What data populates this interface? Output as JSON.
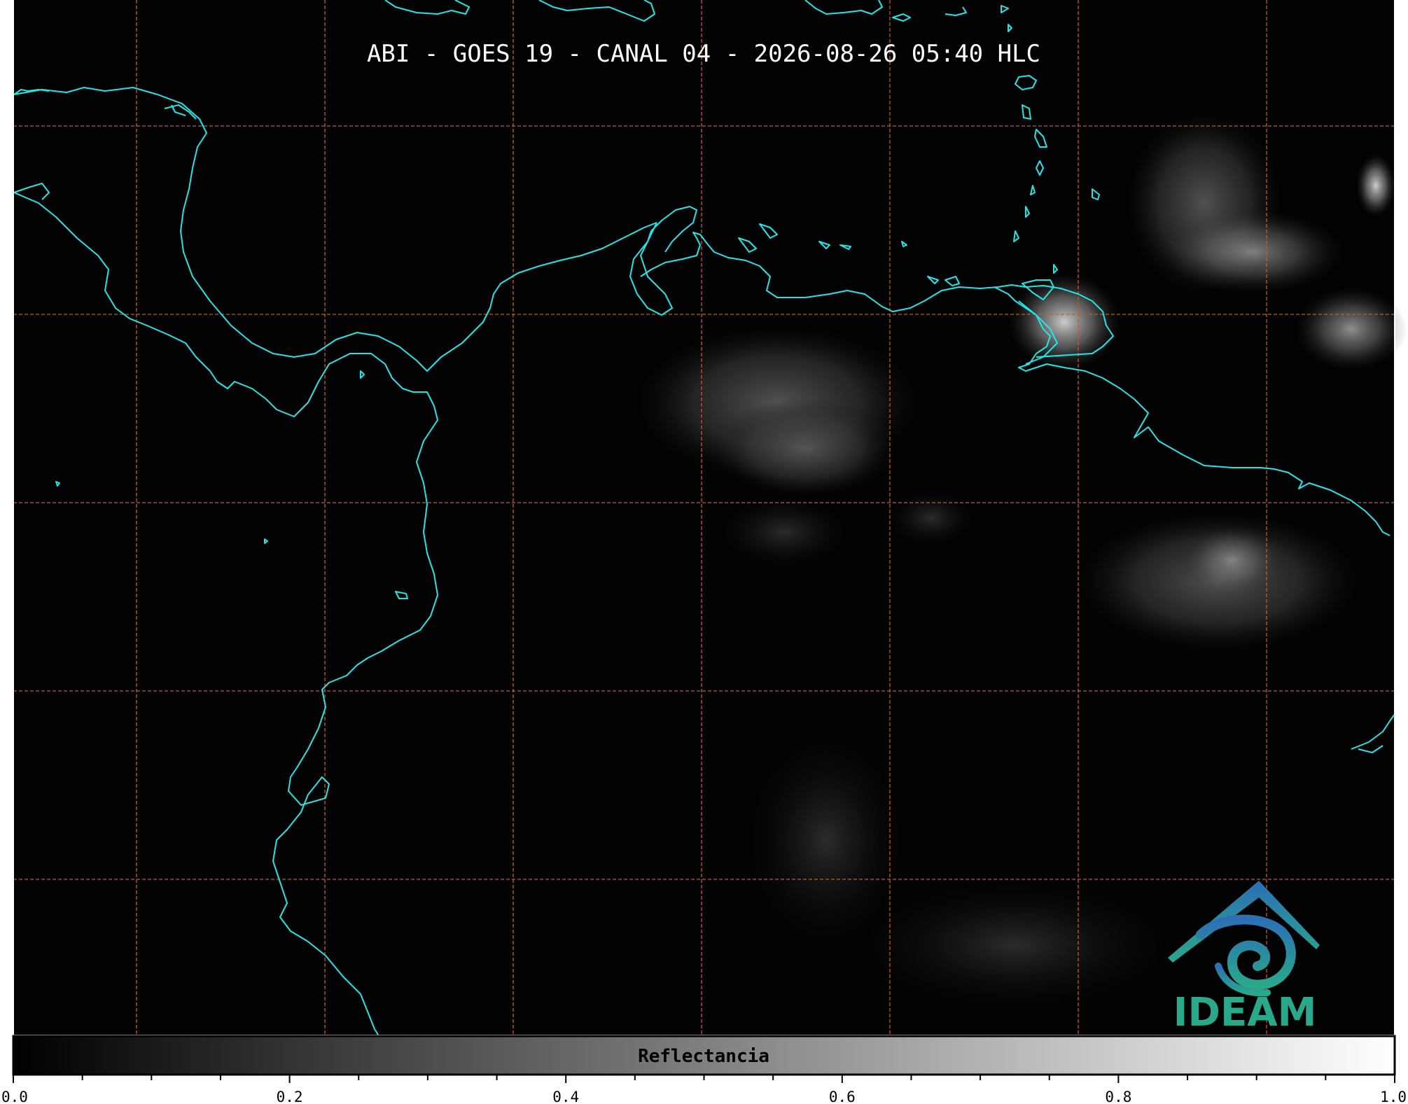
{
  "title": "ABI - GOES 19 - CANAL 04 - 2026-08-26 05:40 HLC",
  "colorbar": {
    "label": "Reflectancia",
    "range": [
      0.0,
      1.0
    ],
    "ticks": [
      "0.0",
      "0.2",
      "0.4",
      "0.6",
      "0.8",
      "1.0"
    ],
    "minor_step": 0.05
  },
  "logo": {
    "text": "IDEAM",
    "color": "#2aa88a",
    "accent": "#2b6fb5"
  },
  "colors": {
    "background": "#020202",
    "coastline": "#22e6e6",
    "grid": "#c0602a"
  }
}
